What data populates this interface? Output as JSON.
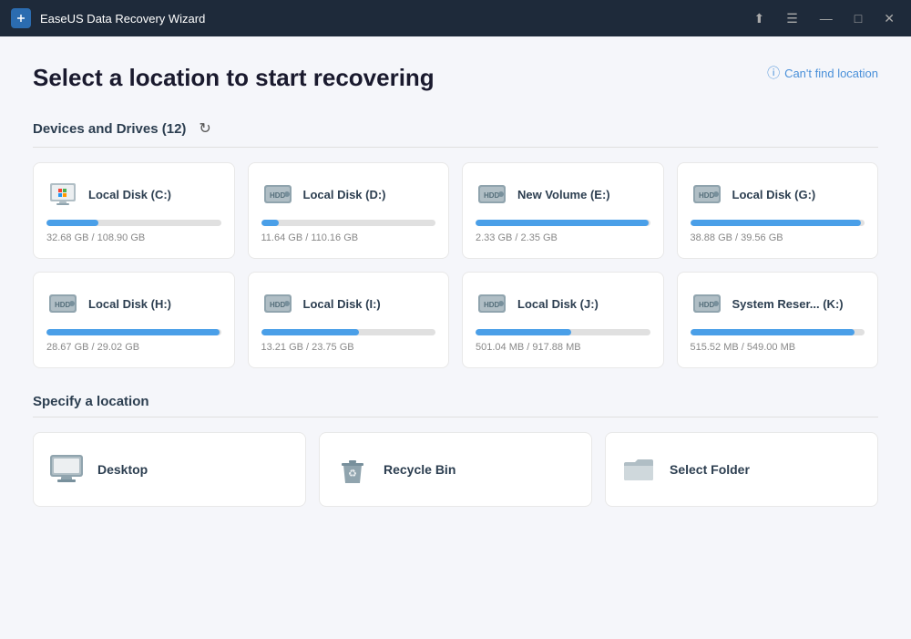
{
  "app": {
    "title": "EaseUS Data Recovery Wizard",
    "cant_find_label": "Can't find location"
  },
  "titlebar": {
    "controls": {
      "share": "⬆",
      "menu": "☰",
      "minimize": "—",
      "maximize": "□",
      "close": "✕"
    }
  },
  "page": {
    "title": "Select a location to start recovering",
    "devices_section": "Devices and Drives (12)",
    "specify_section": "Specify a location"
  },
  "drives": [
    {
      "name": "Local Disk (C:)",
      "size": "32.68 GB / 108.90 GB",
      "pct": 30,
      "type": "windows"
    },
    {
      "name": "Local Disk (D:)",
      "size": "11.64 GB / 110.16 GB",
      "pct": 10,
      "type": "hdd"
    },
    {
      "name": "New Volume (E:)",
      "size": "2.33 GB / 2.35 GB",
      "pct": 99,
      "type": "hdd"
    },
    {
      "name": "Local Disk (G:)",
      "size": "38.88 GB / 39.56 GB",
      "pct": 98,
      "type": "hdd"
    },
    {
      "name": "Local Disk (H:)",
      "size": "28.67 GB / 29.02 GB",
      "pct": 99,
      "type": "hdd"
    },
    {
      "name": "Local Disk (I:)",
      "size": "13.21 GB / 23.75 GB",
      "pct": 56,
      "type": "hdd"
    },
    {
      "name": "Local Disk (J:)",
      "size": "501.04 MB / 917.88 MB",
      "pct": 55,
      "type": "hdd"
    },
    {
      "name": "System Reser... (K:)",
      "size": "515.52 MB / 549.00 MB",
      "pct": 94,
      "type": "hdd"
    }
  ],
  "locations": [
    {
      "name": "Desktop",
      "icon": "desktop"
    },
    {
      "name": "Recycle Bin",
      "icon": "recycle"
    },
    {
      "name": "Select Folder",
      "icon": "folder"
    }
  ]
}
